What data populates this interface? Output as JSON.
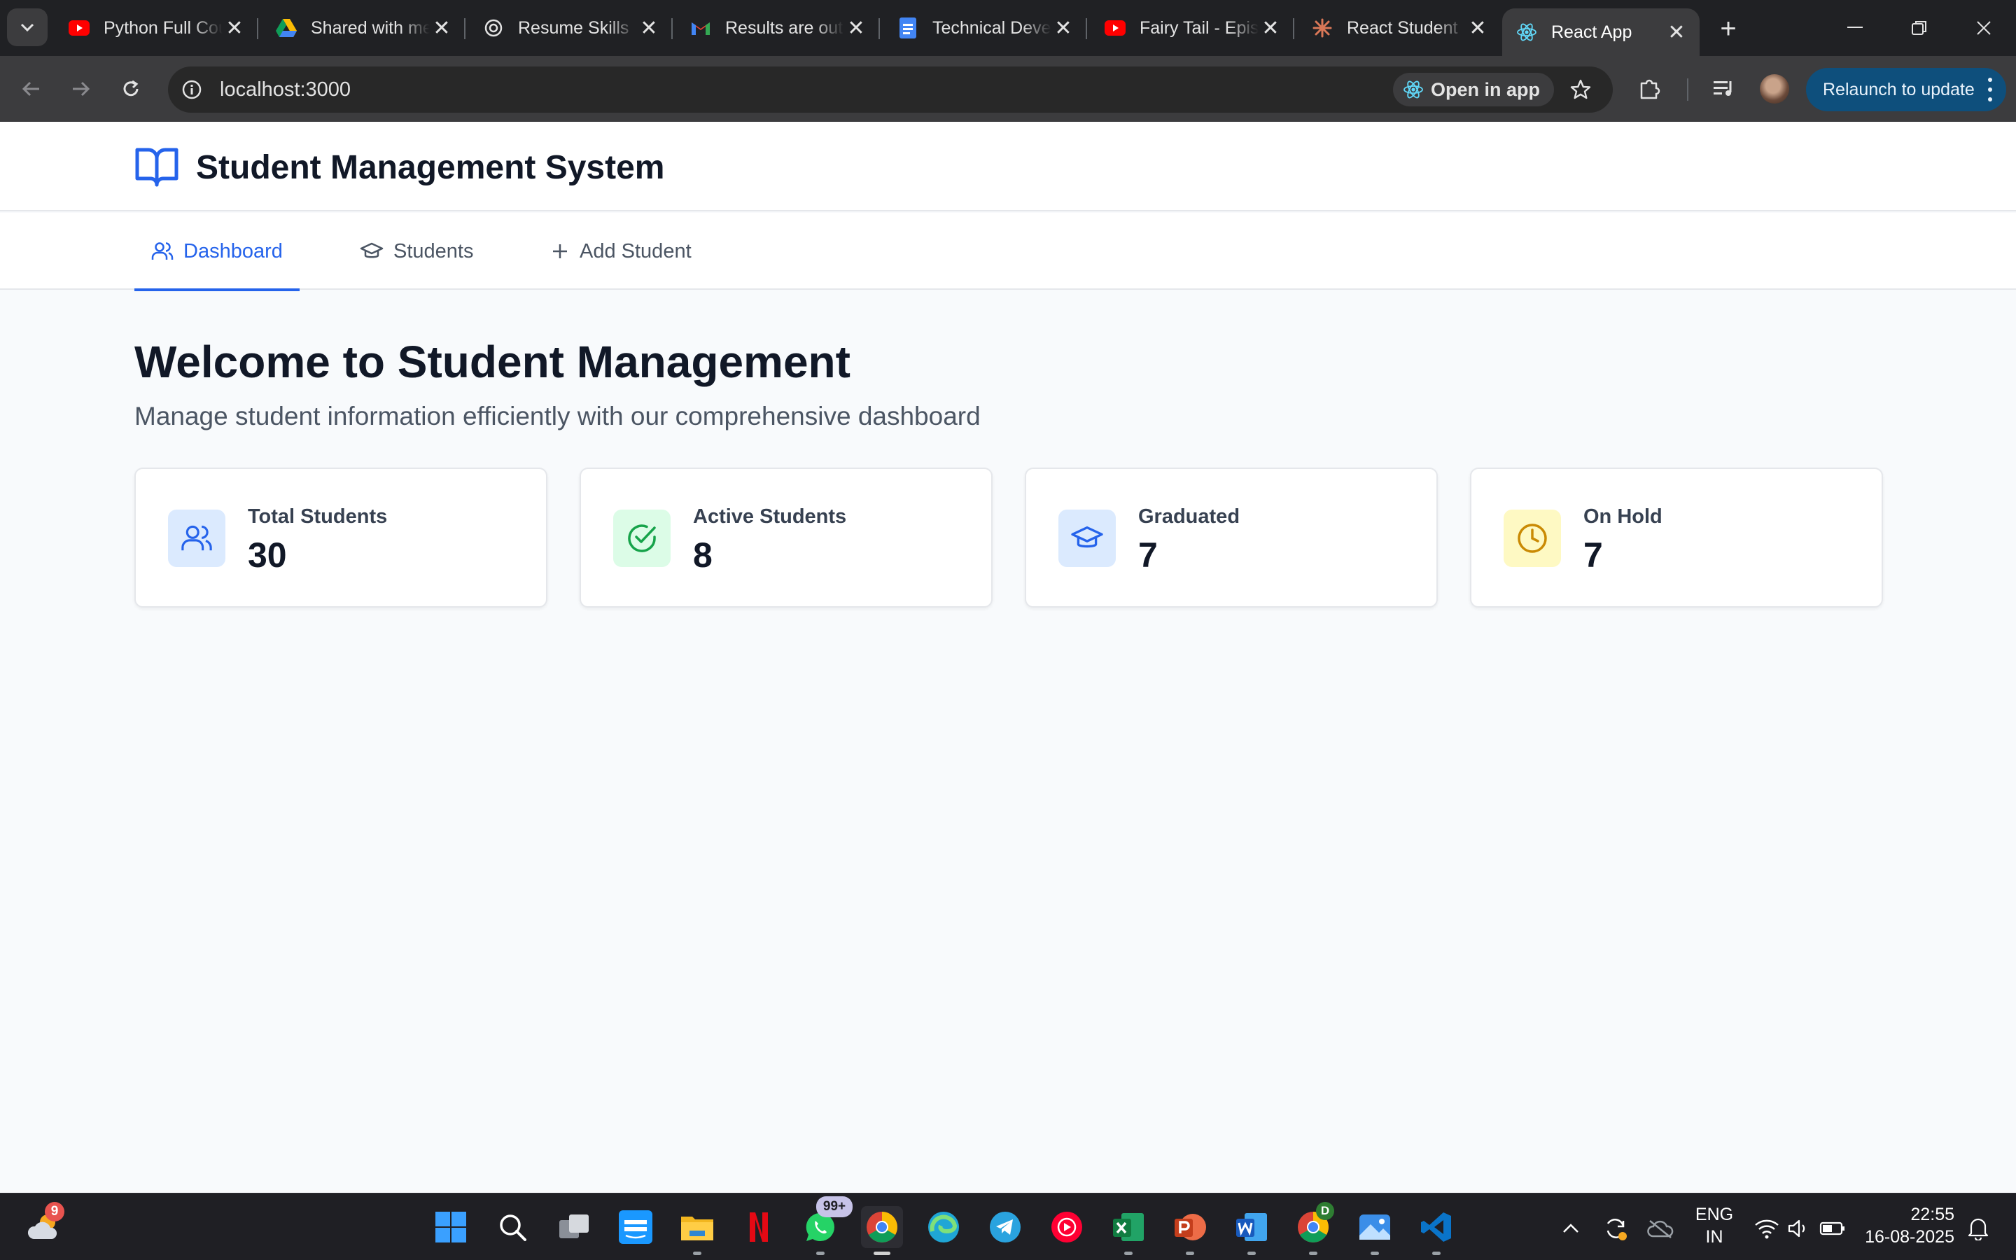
{
  "browser": {
    "tabs": [
      {
        "title": "Python Full Course",
        "favicon": "youtube-icon"
      },
      {
        "title": "Shared with me",
        "favicon": "google-drive-icon"
      },
      {
        "title": "Resume Skills",
        "favicon": "chatgpt-icon"
      },
      {
        "title": "Results are out",
        "favicon": "gmail-icon"
      },
      {
        "title": "Technical Developer",
        "favicon": "google-docs-icon"
      },
      {
        "title": "Fairy Tail - Episode",
        "favicon": "youtube-icon"
      },
      {
        "title": "React Student",
        "favicon": "claude-icon"
      },
      {
        "title": "React App",
        "favicon": "react-icon",
        "active": true
      }
    ],
    "url": "localhost:3000",
    "open_in_app_label": "Open in app",
    "relaunch_label": "Relaunch to update",
    "colors": {
      "chrome_dark": "#202124",
      "toolbar": "#3c3c3e",
      "relaunch_bg": "#0e4f7c"
    }
  },
  "app": {
    "title": "Student Management System",
    "nav": {
      "dashboard": "Dashboard",
      "students": "Students",
      "add_student": "Add Student"
    },
    "welcome_heading": "Welcome to Student Management",
    "welcome_subtitle": "Manage student information efficiently with our comprehensive dashboard",
    "stats": [
      {
        "label": "Total Students",
        "value": "30",
        "icon": "users-icon",
        "color": "#2563eb",
        "bg": "#dbeafe"
      },
      {
        "label": "Active Students",
        "value": "8",
        "icon": "check-circle-icon",
        "color": "#16a34a",
        "bg": "#dcfce7"
      },
      {
        "label": "Graduated",
        "value": "7",
        "icon": "graduation-cap-icon",
        "color": "#2563eb",
        "bg": "#dbeafe"
      },
      {
        "label": "On Hold",
        "value": "7",
        "icon": "clock-icon",
        "color": "#ca8a04",
        "bg": "#fef9c3"
      }
    ],
    "colors": {
      "accent": "#2563eb",
      "page_bg": "#f8fafc",
      "text": "#111827"
    }
  },
  "taskbar": {
    "weather_badge": "9",
    "whatsapp_badge": "99+",
    "chrome_profile_badge": "D",
    "language": "ENG",
    "region": "IN",
    "time": "22:55",
    "date": "16-08-2025"
  }
}
